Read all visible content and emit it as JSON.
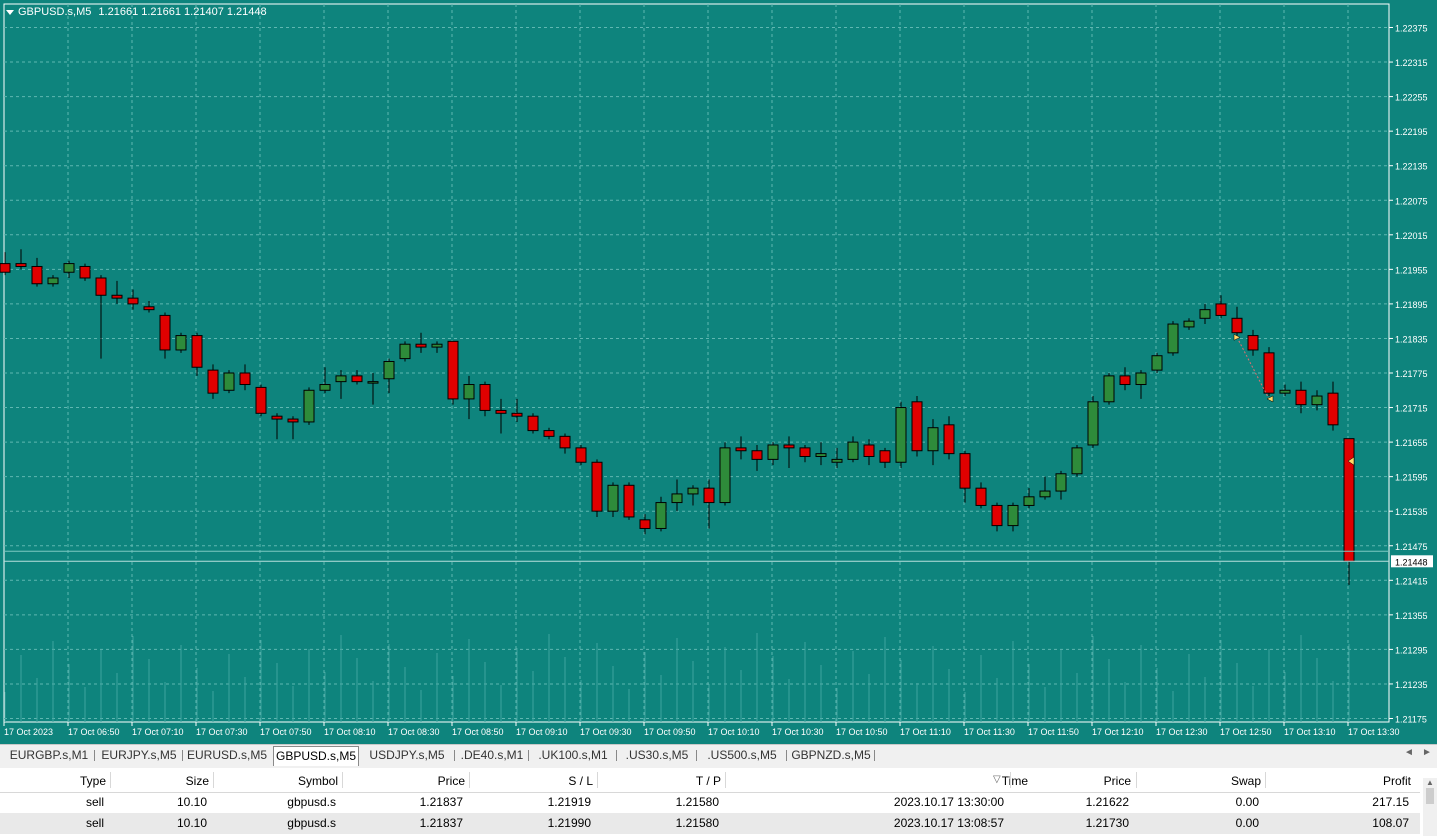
{
  "chart": {
    "symbol": "GBPUSD.s,M5",
    "ohlc_text": "1.21661 1.21661 1.21407 1.21448",
    "current_price": "1.21448",
    "price_labels": [
      "1.22375",
      "1.22315",
      "1.22255",
      "1.22195",
      "1.22135",
      "1.22075",
      "1.22015",
      "1.21955",
      "1.21895",
      "1.21835",
      "1.21775",
      "1.21715",
      "1.21655",
      "1.21595",
      "1.21535",
      "1.21475",
      "1.21415",
      "1.21355",
      "1.21295",
      "1.21235",
      "1.21175"
    ],
    "time_labels": [
      "17 Oct 2023",
      "17 Oct 06:50",
      "17 Oct 07:10",
      "17 Oct 07:30",
      "17 Oct 07:50",
      "17 Oct 08:10",
      "17 Oct 08:30",
      "17 Oct 08:50",
      "17 Oct 09:10",
      "17 Oct 09:30",
      "17 Oct 09:50",
      "17 Oct 10:10",
      "17 Oct 10:30",
      "17 Oct 10:50",
      "17 Oct 11:10",
      "17 Oct 11:30",
      "17 Oct 11:50",
      "17 Oct 12:10",
      "17 Oct 12:30",
      "17 Oct 12:50",
      "17 Oct 13:10",
      "17 Oct 13:30"
    ],
    "colors": {
      "background": "#0e847d",
      "bull": "#2e8b3a",
      "bear": "#e00000",
      "grid": "#5fb7b1"
    }
  },
  "chart_data": {
    "type": "candlestick",
    "ylim": [
      1.21145,
      1.22405
    ],
    "candles": [
      [
        1.21965,
        1.21985,
        1.21945,
        1.2195
      ],
      [
        1.21965,
        1.2199,
        1.21955,
        1.2196
      ],
      [
        1.2196,
        1.21975,
        1.21925,
        1.2193
      ],
      [
        1.2193,
        1.21945,
        1.21925,
        1.2194
      ],
      [
        1.2195,
        1.2197,
        1.2194,
        1.21965
      ],
      [
        1.2196,
        1.21965,
        1.21935,
        1.2194
      ],
      [
        1.2194,
        1.21945,
        1.218,
        1.2191
      ],
      [
        1.2191,
        1.21935,
        1.21895,
        1.21905
      ],
      [
        1.21905,
        1.2192,
        1.21885,
        1.21895
      ],
      [
        1.2189,
        1.219,
        1.2188,
        1.21885
      ],
      [
        1.21875,
        1.2188,
        1.218,
        1.21815
      ],
      [
        1.21815,
        1.21845,
        1.2181,
        1.2184
      ],
      [
        1.2184,
        1.21845,
        1.2177,
        1.21785
      ],
      [
        1.2178,
        1.2179,
        1.2173,
        1.2174
      ],
      [
        1.21745,
        1.2178,
        1.2174,
        1.21775
      ],
      [
        1.21775,
        1.2179,
        1.21745,
        1.21755
      ],
      [
        1.2175,
        1.21755,
        1.217,
        1.21705
      ],
      [
        1.217,
        1.21705,
        1.2166,
        1.21695
      ],
      [
        1.21695,
        1.217,
        1.2166,
        1.2169
      ],
      [
        1.2169,
        1.2175,
        1.21685,
        1.21745
      ],
      [
        1.21745,
        1.21785,
        1.2174,
        1.21755
      ],
      [
        1.2176,
        1.2178,
        1.2173,
        1.2177
      ],
      [
        1.2177,
        1.2178,
        1.21755,
        1.2176
      ],
      [
        1.2176,
        1.21775,
        1.2172,
        1.2176
      ],
      [
        1.21765,
        1.218,
        1.2174,
        1.21795
      ],
      [
        1.218,
        1.2183,
        1.21795,
        1.21825
      ],
      [
        1.21825,
        1.21845,
        1.2181,
        1.2182
      ],
      [
        1.2182,
        1.2183,
        1.2181,
        1.21825
      ],
      [
        1.2183,
        1.2183,
        1.2172,
        1.2173
      ],
      [
        1.2173,
        1.2177,
        1.21695,
        1.21755
      ],
      [
        1.21755,
        1.2176,
        1.217,
        1.2171
      ],
      [
        1.2171,
        1.2173,
        1.2167,
        1.21705
      ],
      [
        1.21705,
        1.2173,
        1.2169,
        1.217
      ],
      [
        1.217,
        1.21705,
        1.2167,
        1.21675
      ],
      [
        1.21675,
        1.2168,
        1.2166,
        1.21665
      ],
      [
        1.21665,
        1.2167,
        1.21635,
        1.21645
      ],
      [
        1.21645,
        1.2165,
        1.21615,
        1.2162
      ],
      [
        1.2162,
        1.21625,
        1.21525,
        1.21535
      ],
      [
        1.21535,
        1.21585,
        1.21525,
        1.2158
      ],
      [
        1.2158,
        1.21585,
        1.2152,
        1.21525
      ],
      [
        1.2152,
        1.2153,
        1.21495,
        1.21505
      ],
      [
        1.21505,
        1.2156,
        1.215,
        1.2155
      ],
      [
        1.2155,
        1.2159,
        1.21535,
        1.21565
      ],
      [
        1.21565,
        1.2158,
        1.21545,
        1.21575
      ],
      [
        1.21575,
        1.2159,
        1.21505,
        1.2155
      ],
      [
        1.2155,
        1.21655,
        1.21545,
        1.21645
      ],
      [
        1.21645,
        1.21665,
        1.21625,
        1.2164
      ],
      [
        1.2164,
        1.2165,
        1.21605,
        1.21625
      ],
      [
        1.21625,
        1.21655,
        1.21615,
        1.2165
      ],
      [
        1.2165,
        1.21665,
        1.2161,
        1.21645
      ],
      [
        1.21645,
        1.2165,
        1.2162,
        1.2163
      ],
      [
        1.2163,
        1.21655,
        1.21615,
        1.21635
      ],
      [
        1.2162,
        1.21645,
        1.2161,
        1.21625
      ],
      [
        1.21625,
        1.21665,
        1.2162,
        1.21655
      ],
      [
        1.2165,
        1.2166,
        1.21615,
        1.2163
      ],
      [
        1.2164,
        1.21645,
        1.2161,
        1.2162
      ],
      [
        1.2162,
        1.21725,
        1.2161,
        1.21715
      ],
      [
        1.21725,
        1.21735,
        1.2163,
        1.2164
      ],
      [
        1.2164,
        1.21695,
        1.21615,
        1.2168
      ],
      [
        1.21685,
        1.217,
        1.21625,
        1.21635
      ],
      [
        1.21635,
        1.2164,
        1.2155,
        1.21575
      ],
      [
        1.21575,
        1.21585,
        1.2154,
        1.21545
      ],
      [
        1.21545,
        1.2155,
        1.215,
        1.2151
      ],
      [
        1.2151,
        1.2155,
        1.215,
        1.21545
      ],
      [
        1.21545,
        1.21575,
        1.2154,
        1.2156
      ],
      [
        1.2156,
        1.21595,
        1.21555,
        1.2157
      ],
      [
        1.2157,
        1.21605,
        1.21555,
        1.216
      ],
      [
        1.216,
        1.2165,
        1.21595,
        1.21645
      ],
      [
        1.2165,
        1.21735,
        1.21645,
        1.21725
      ],
      [
        1.21725,
        1.21775,
        1.2172,
        1.2177
      ],
      [
        1.2177,
        1.21785,
        1.21745,
        1.21755
      ],
      [
        1.21755,
        1.2178,
        1.2173,
        1.21775
      ],
      [
        1.2178,
        1.2181,
        1.21775,
        1.21805
      ],
      [
        1.2181,
        1.21865,
        1.21805,
        1.2186
      ],
      [
        1.21855,
        1.2187,
        1.2185,
        1.21865
      ],
      [
        1.2187,
        1.21895,
        1.2186,
        1.21885
      ],
      [
        1.21895,
        1.2191,
        1.2187,
        1.21875
      ],
      [
        1.2187,
        1.2189,
        1.21835,
        1.21845
      ],
      [
        1.2184,
        1.2185,
        1.21805,
        1.21815
      ],
      [
        1.2181,
        1.2182,
        1.21735,
        1.2174
      ],
      [
        1.2174,
        1.21755,
        1.21735,
        1.21745
      ],
      [
        1.21745,
        1.2176,
        1.21705,
        1.2172
      ],
      [
        1.2172,
        1.21745,
        1.2171,
        1.21735
      ],
      [
        1.2174,
        1.2176,
        1.21675,
        1.21685
      ],
      [
        1.21661,
        1.21661,
        1.21407,
        1.21448
      ]
    ]
  },
  "tabs": [
    {
      "label": "EURGBP.s,M1",
      "active": false
    },
    {
      "label": "EURJPY.s,M5",
      "active": false
    },
    {
      "label": "EURUSD.s,M5",
      "active": false
    },
    {
      "label": "GBPUSD.s,M5",
      "active": true
    },
    {
      "label": "USDJPY.s,M5",
      "active": false
    },
    {
      "label": ".DE40.s,M1",
      "active": false
    },
    {
      "label": ".UK100.s,M1",
      "active": false
    },
    {
      "label": ".US30.s,M5",
      "active": false
    },
    {
      "label": ".US500.s,M5",
      "active": false
    },
    {
      "label": "GBPNZD.s,M5",
      "active": false
    }
  ],
  "table": {
    "headers": [
      "Type",
      "Size",
      "Symbol",
      "Price",
      "S / L",
      "T / P",
      "Time",
      "Price",
      "Swap",
      "Profit"
    ],
    "sort_indicator": "▽",
    "rows": [
      [
        "sell",
        "10.10",
        "gbpusd.s",
        "1.21837",
        "1.21919",
        "1.21580",
        "2023.10.17 13:30:00",
        "1.21622",
        "0.00",
        "217.15"
      ],
      [
        "sell",
        "10.10",
        "gbpusd.s",
        "1.21837",
        "1.21990",
        "1.21580",
        "2023.10.17 13:08:57",
        "1.21730",
        "0.00",
        "108.07"
      ]
    ]
  }
}
